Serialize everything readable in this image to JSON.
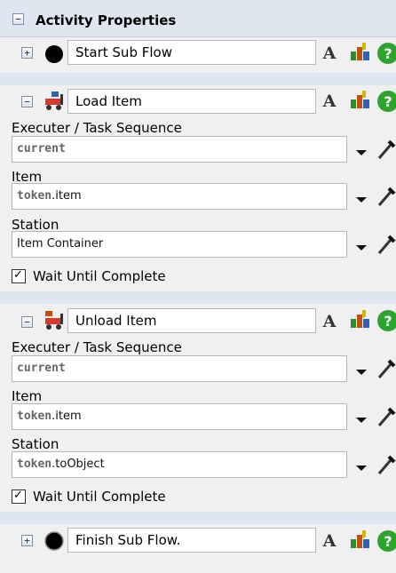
{
  "panel": {
    "title": "Activity Properties",
    "expander_symbol": "−"
  },
  "activities": {
    "start": {
      "name": "Start Sub Flow",
      "expander": "+"
    },
    "load": {
      "name": "Load Item",
      "expander": "−",
      "executer_label": "Executer / Task Sequence",
      "executer_value": "current",
      "item_label": "Item",
      "item_kw": "token",
      "item_rest": ".item",
      "station_label": "Station",
      "station_value": "Item Container",
      "wait_label": "Wait Until Complete",
      "wait_checked": "✓"
    },
    "unload": {
      "name": "Unload Item",
      "expander": "−",
      "executer_label": "Executer / Task Sequence",
      "executer_value": "current",
      "item_label": "Item",
      "item_kw": "token",
      "item_rest": ".item",
      "station_label": "Station",
      "station_kw": "token",
      "station_rest": ".toObject",
      "wait_label": "Wait Until Complete",
      "wait_checked": "✓"
    },
    "finish": {
      "name": "Finish Sub Flow.",
      "expander": "+"
    }
  },
  "buttons": {
    "font_label": "A"
  },
  "icons": {
    "start": "filled-circle-icon",
    "finish": "ring-circle-icon",
    "load": "forklift-load-icon",
    "unload": "forklift-unload-icon",
    "palette": "color-palette-icon",
    "help": "help-icon",
    "picker": "eyedropper-icon"
  },
  "colors": {
    "header_bg": "#dfe6ef",
    "help_green": "#2fa32f",
    "keyword": "#666666"
  }
}
